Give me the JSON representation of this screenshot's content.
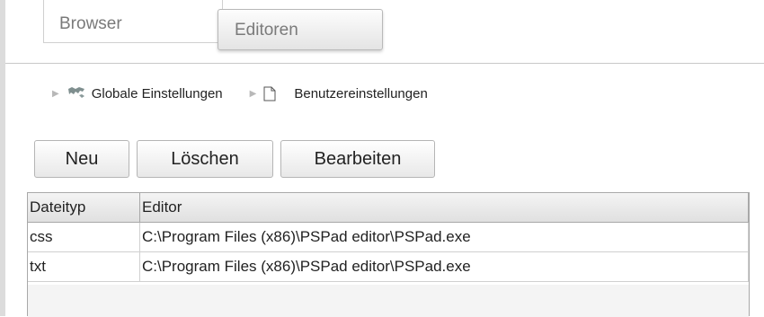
{
  "tabs": [
    "Browser",
    "Editoren"
  ],
  "breadcrumbs": [
    "Globale Einstellungen",
    "Benutzereinstellungen"
  ],
  "buttons": {
    "new": "Neu",
    "delete": "Löschen",
    "edit": "Bearbeiten"
  },
  "table": {
    "headers": [
      "Dateityp",
      "Editor"
    ],
    "rows": [
      [
        "css",
        "C:\\Program Files (x86)\\PSPad editor\\PSPad.exe"
      ],
      [
        "txt",
        "C:\\Program Files (x86)\\PSPad editor\\PSPad.exe"
      ]
    ]
  },
  "icons": [
    "map-icon",
    "document-icon",
    "triangle-right-icon"
  ]
}
